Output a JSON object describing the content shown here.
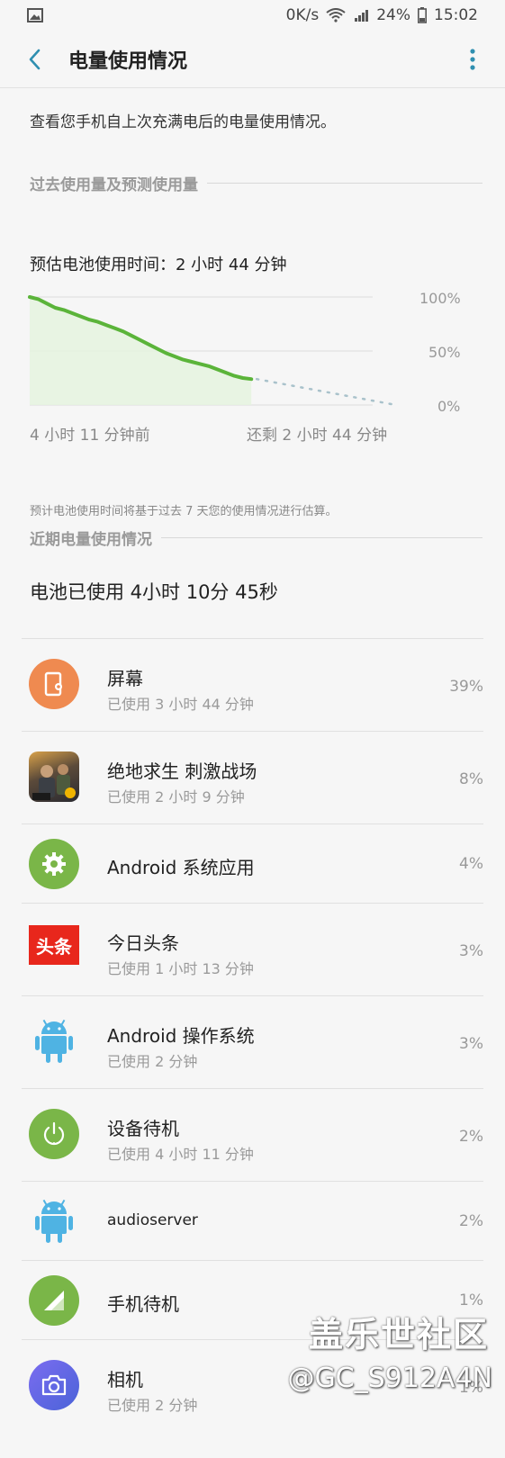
{
  "status": {
    "speed": "0K/s",
    "battery": "24%",
    "time": "15:02"
  },
  "appbar": {
    "title": "电量使用情况"
  },
  "description": "查看您手机自上次充满电后的电量使用情况。",
  "section1": {
    "label": "过去使用量及预测使用量"
  },
  "estimate": "预估电池使用时间：2 小时 44 分钟",
  "chart_data": {
    "type": "line",
    "y_tick_labels": [
      "100%",
      "50%",
      "0%"
    ],
    "ylim": [
      0,
      100
    ],
    "x_labels": {
      "start": "4 小时 11 分钟前",
      "end": "还剩 2 小时 44 分钟"
    },
    "series": [
      {
        "values_past": [
          100,
          98,
          94,
          90,
          88,
          85,
          82,
          79,
          77,
          74,
          71,
          68,
          64,
          60,
          56,
          52,
          48,
          45,
          42,
          40,
          38,
          36,
          33,
          30,
          27,
          25,
          24
        ]
      },
      {
        "values_projected": [
          24,
          0
        ]
      }
    ],
    "colors": {
      "line": "#5bb43a",
      "fill": "#e5f3df",
      "projection": "#a9c2cb",
      "grid": "#dcdcdc"
    }
  },
  "note": "预计电池使用时间将基于过去 7 天您的使用情况进行估算。",
  "section2": {
    "label": "近期电量使用情况"
  },
  "used_total": "电池已使用 4小时 10分 45秒",
  "apps": [
    {
      "name": "屏幕",
      "sub": "已使用 3 小时 44 分钟",
      "pct": "39%",
      "icon": "screen-icon"
    },
    {
      "name": "绝地求生 刺激战场",
      "sub": "已使用 2 小时 9 分钟",
      "pct": "8%",
      "icon": "pubg-icon"
    },
    {
      "name": "Android 系统应用",
      "sub": "",
      "pct": "4%",
      "icon": "gear-icon"
    },
    {
      "name": "今日头条",
      "sub": "已使用 1 小时 13 分钟",
      "pct": "3%",
      "icon": "toutiao-icon",
      "icon_text": "头条"
    },
    {
      "name": "Android 操作系统",
      "sub": "已使用 2 分钟",
      "pct": "3%",
      "icon": "android-icon"
    },
    {
      "name": "设备待机",
      "sub": "已使用 4 小时 11 分钟",
      "pct": "2%",
      "icon": "power-icon"
    },
    {
      "name": "audioserver",
      "sub": "",
      "pct": "2%",
      "icon": "android-icon"
    },
    {
      "name": "手机待机",
      "sub": "",
      "pct": "1%",
      "icon": "signal-icon"
    },
    {
      "name": "相机",
      "sub": "已使用 2 分钟",
      "pct": "1%",
      "icon": "camera-icon"
    }
  ],
  "watermark": {
    "line1": "盖乐世社区",
    "line2": "@GC_S912A4N"
  }
}
